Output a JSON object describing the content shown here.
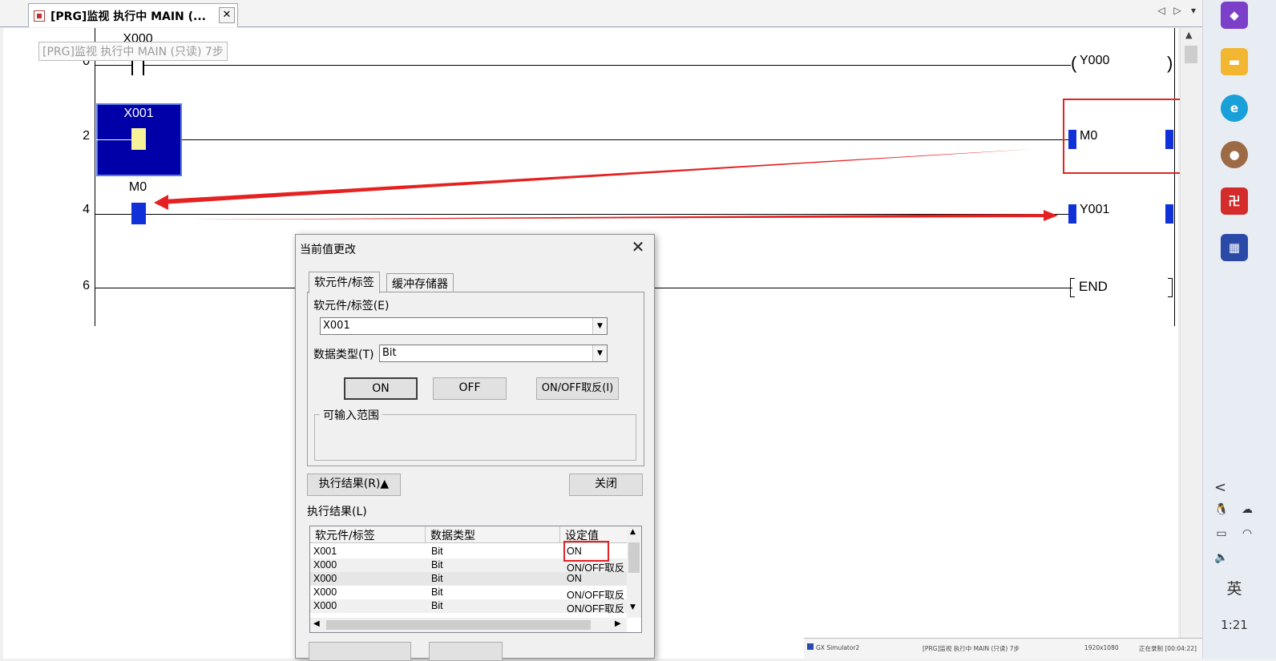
{
  "tab": {
    "title": "[PRG]监视 执行中 MAIN (...",
    "close_glyph": "✕",
    "nav_prev": "◁",
    "nav_next": "▷",
    "nav_menu": "▾"
  },
  "tooltip": "[PRG]监视 执行中 MAIN (只读) 7步",
  "ladder": {
    "rungs": [
      {
        "step": "0",
        "contact": "X000",
        "coil": "Y000"
      },
      {
        "step": "2",
        "contact": "X001",
        "coil": "M0"
      },
      {
        "step": "4",
        "contact": "M0",
        "coil": "Y001"
      },
      {
        "step": "6",
        "coil": "END"
      }
    ]
  },
  "dialog": {
    "title": "当前值更改",
    "close_glyph": "✕",
    "tabs": [
      "软元件/标签",
      "缓冲存储器"
    ],
    "device_label": "软元件/标签(E)",
    "device_value": "X001",
    "datatype_label": "数据类型(T)",
    "datatype_value": "Bit",
    "btn_on": "ON",
    "btn_off": "OFF",
    "btn_toggle": "ON/OFF取反(I)",
    "range_label": "可输入范围",
    "btn_results": "执行结果(R)▲",
    "btn_close": "关闭",
    "results_label": "执行结果(L)",
    "table": {
      "headers": [
        "软元件/标签",
        "数据类型",
        "设定值"
      ],
      "rows": [
        [
          "X001",
          "Bit",
          "ON"
        ],
        [
          "X000",
          "Bit",
          "ON/OFF取反"
        ],
        [
          "X000",
          "Bit",
          "ON"
        ],
        [
          "X000",
          "Bit",
          "ON/OFF取反"
        ],
        [
          "X000",
          "Bit",
          "ON/OFF取反"
        ]
      ]
    }
  },
  "taskbar": {
    "ime": "英",
    "time": "1:21",
    "back_glyph": "<"
  },
  "bottom_strip": {
    "app": "GX Simulator2",
    "window": "[PRG]监视 执行中 MAIN (只读) 7步",
    "resolution": "1920x1080",
    "recording": "正在录制 [00:04:22]"
  }
}
